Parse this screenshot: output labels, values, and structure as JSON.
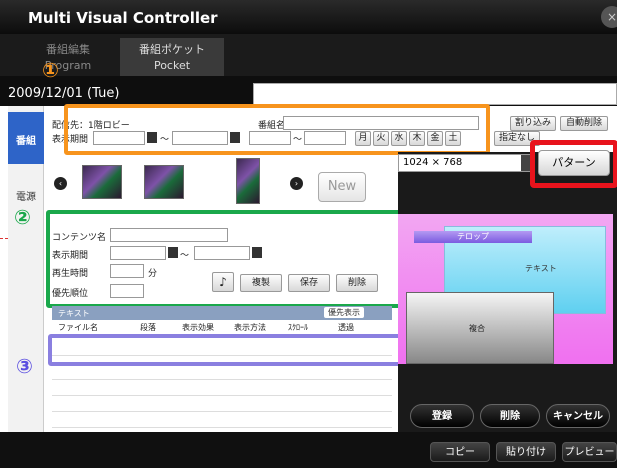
{
  "app": {
    "title": "Multi Visual Controller",
    "close": "×"
  },
  "tabs": [
    {
      "jp": "番組編集",
      "en": "Program"
    },
    {
      "jp": "番組ポケット",
      "en": "Pocket"
    }
  ],
  "date": "2009/12/01 (Tue)",
  "left_tabs": [
    "番組",
    "電源"
  ],
  "schedule": {
    "distributor_label": "配信先：1階ロビー",
    "period_label": "表示期間",
    "tilde": "～",
    "program_name_label": "番組名",
    "days": [
      "月",
      "火",
      "水",
      "木",
      "金",
      "土"
    ],
    "buttons": {
      "interrupt": "割り込み",
      "auto_delete": "自動削除",
      "specify": "指定なし"
    }
  },
  "markers": {
    "one": "①",
    "two": "②",
    "three": "③"
  },
  "new_button": "New",
  "content": {
    "name_label": "コンテンツ名",
    "period_label": "表示期間",
    "playtime_label": "再生時間",
    "minutes": "分",
    "priority_label": "優先順位",
    "music_icon": "♪",
    "buttons": {
      "copy": "複製",
      "save": "保存",
      "delete": "削除"
    }
  },
  "table": {
    "header": "テキスト",
    "header_btn": "優先表示",
    "columns": [
      "ファイル名",
      "段落",
      "表示効果",
      "表示方法",
      "ｽｸﾛｰﾙ",
      "透過"
    ]
  },
  "resolution": "1024 × 768",
  "pattern_button": "パターン",
  "layout": {
    "telop": "テロップ",
    "text": "テキスト",
    "composite": "複合"
  },
  "actions": {
    "register": "登録",
    "delete": "削除",
    "cancel": "キャンセル"
  },
  "bottom": {
    "copy": "コピー",
    "paste": "貼り付け",
    "preview": "プレビュー"
  }
}
